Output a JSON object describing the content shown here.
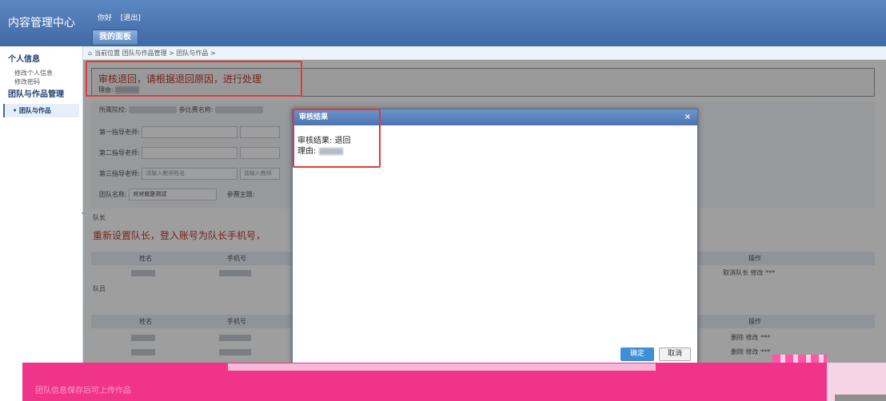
{
  "header": {
    "title": "内容管理中心",
    "greeting": "你好",
    "logout": "[退出]",
    "tab": "我的面板"
  },
  "sidebar": {
    "section1": "个人信息",
    "links": [
      "修改个人信息",
      "修改密码"
    ],
    "section2": "团队与作品管理",
    "active_item": "团队与作品"
  },
  "breadcrumb": "当前位置 团队与作品管理 > 团队与作品 >",
  "notice": {
    "title": "审核退回，请根据退回原因，进行处理",
    "reason_label": "理由:"
  },
  "form": {
    "school_label": "所属院校:",
    "competition_label": "参比赛名称:",
    "teacher1_label": "第一指导老师:",
    "teacher2_label": "第二指导老师:",
    "teacher3_label": "第三指导老师:",
    "teacher3_placeholder": "请输入教师姓名",
    "teacher3_phone_placeholder": "请输入教师",
    "team_label": "团队名称:",
    "team_value": "对对就是测试",
    "topic_label": "参赛主题:"
  },
  "captain": {
    "caption": "队长",
    "reset_msg": "重新设置队长，登入账号为队长手机号，",
    "columns": [
      "姓名",
      "手机号",
      "操作"
    ],
    "row_action": "取消队长 修改 ***"
  },
  "members": {
    "caption": "队员",
    "columns": [
      "姓名",
      "手机号",
      "操作"
    ],
    "row_actions": [
      "删除 修改 ***",
      "删除 修改 ***"
    ]
  },
  "modal": {
    "title": "审核结果",
    "close": "×",
    "result_line": "审核结果: 退回",
    "reason_line": "理由:",
    "ok": "确定",
    "cancel": "取消"
  },
  "banner": {
    "text": "团队信息保存后可上传作品"
  }
}
